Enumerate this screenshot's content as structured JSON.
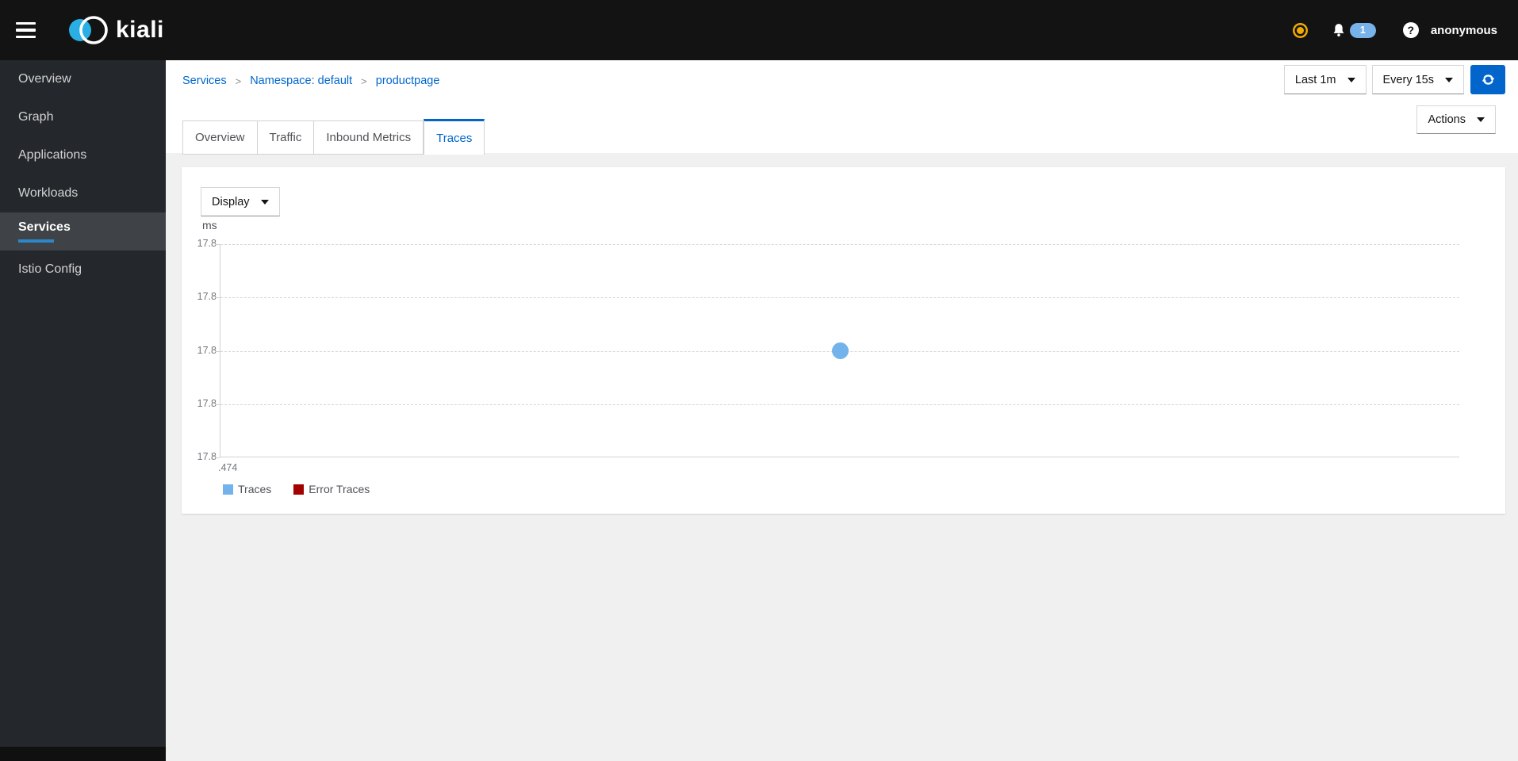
{
  "masthead": {
    "brand": "kiali",
    "username": "anonymous",
    "notifications": {
      "badge_count": "1"
    },
    "help_glyph": "?",
    "icons": {
      "hamburger": "menu",
      "status": "amber-system-status",
      "bell": "notifications",
      "help": "question-mark-circle"
    }
  },
  "sidebar": {
    "items": [
      {
        "label": "Overview",
        "active": false
      },
      {
        "label": "Graph",
        "active": false
      },
      {
        "label": "Applications",
        "active": false
      },
      {
        "label": "Workloads",
        "active": false
      },
      {
        "label": "Services",
        "active": true
      },
      {
        "label": "Istio Config",
        "active": false
      }
    ]
  },
  "breadcrumb": {
    "separator": ">",
    "items": [
      {
        "label": "Services"
      },
      {
        "label": "Namespace: default"
      },
      {
        "label": "productpage"
      }
    ]
  },
  "toolbar": {
    "duration": "Last 1m",
    "refresh_interval": "Every 15s",
    "actions": "Actions"
  },
  "tabs": [
    {
      "label": "Overview",
      "active": false
    },
    {
      "label": "Traffic",
      "active": false
    },
    {
      "label": "Inbound Metrics",
      "active": false
    },
    {
      "label": "Traces",
      "active": true
    }
  ],
  "traces_panel": {
    "display_button": "Display",
    "y_unit": "ms"
  },
  "chart_data": {
    "type": "scatter",
    "title": "",
    "xlabel": "",
    "ylabel": "ms",
    "grid": "dashed-horizontal",
    "legend_position": "bottom-left",
    "y_tick_labels": [
      "17.8",
      "17.8",
      "17.8",
      "17.8",
      "17.8"
    ],
    "x_tick_labels": [
      ".474"
    ],
    "series": [
      {
        "name": "Traces",
        "color": "#73b3ec",
        "points": [
          {
            "x_label": ".474",
            "y": 17.8,
            "x_frac": 0.5,
            "y_frac": 0.5
          }
        ]
      },
      {
        "name": "Error Traces",
        "color": "#a30000",
        "points": []
      }
    ]
  },
  "colors": {
    "accent_blue": "#0066cc",
    "masthead_bg": "#131313",
    "sidebar_active_accent": "#2b87c8",
    "status_amber": "#f0ab00",
    "badge_bg": "#77b2e8",
    "trace_point": "#73b3ec",
    "error_trace": "#a30000"
  }
}
